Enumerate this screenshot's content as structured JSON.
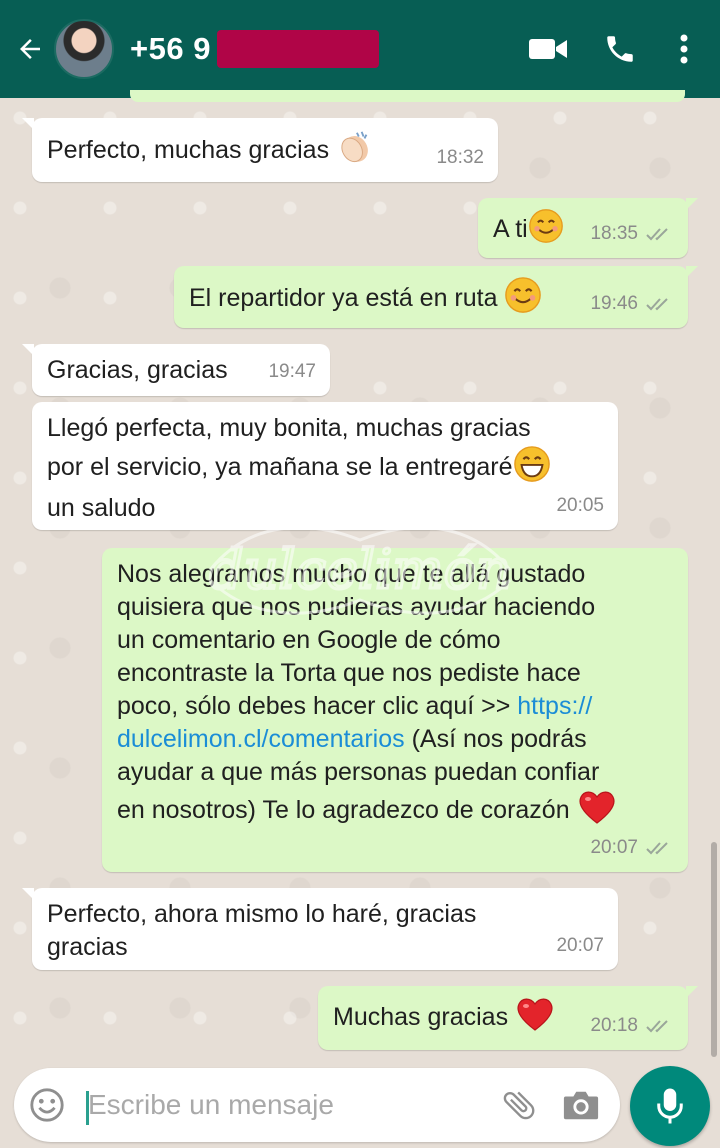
{
  "header": {
    "contact_name": "+56 9",
    "colors": {
      "bar": "#075e54",
      "redaction": "#b00547"
    },
    "icons": [
      "back-arrow-icon",
      "video-call-icon",
      "phone-icon",
      "more-vert-icon"
    ]
  },
  "messages": [
    {
      "dir": "in",
      "text": "Perfecto, muchas gracias",
      "emoji": "clapping-hands",
      "time": "18:32"
    },
    {
      "dir": "out",
      "text": "A ti",
      "emoji": "smiling-face",
      "time": "18:35",
      "read": true
    },
    {
      "dir": "out",
      "text": "El repartidor ya está en ruta",
      "emoji": "smiling-face",
      "time": "19:46",
      "read": true
    },
    {
      "dir": "in",
      "text": "Gracias, gracias",
      "time": "19:47"
    },
    {
      "dir": "in",
      "line1": "Llegó perfecta, muy bonita, muchas gracias",
      "line2": "por el servicio, ya mañana se la entregaré",
      "line3": "un saludo",
      "emoji": "grinning-face",
      "time": "20:05"
    },
    {
      "dir": "out",
      "line1": "Nos alegramos mucho que te allá gustado",
      "line2": "quisiera que nos pudieras ayudar haciendo",
      "line3": "un comentario en Google de cómo",
      "line4": "encontraste la Torta que nos pediste hace",
      "line5": "poco, sólo debes hacer clic aquí >> ",
      "link_a": "https://",
      "link_b": "dulcelimon.cl/comentarios",
      "line6_rest": " (Así nos podrás",
      "line7": "ayudar a que más personas puedan confiar",
      "line8": "en nosotros) Te lo agradezco de corazón",
      "emoji": "red-heart",
      "time": "20:07",
      "read": true
    },
    {
      "dir": "in",
      "line1": "Perfecto, ahora mismo lo haré, gracias",
      "line2": "gracias",
      "time": "20:07"
    },
    {
      "dir": "out",
      "text": "Muchas gracias",
      "emoji": "red-heart",
      "time": "20:18",
      "read": true
    }
  ],
  "watermark": {
    "text": "dulcelimón"
  },
  "composer": {
    "placeholder": "Escribe un mensaje",
    "icons": [
      "emoji-icon",
      "attach-icon",
      "camera-icon",
      "mic-icon"
    ],
    "colors": {
      "send": "#00897b",
      "caret": "#2aa08f"
    }
  },
  "theme": {
    "incoming": "#ffffff",
    "outgoing": "#dcf8c6",
    "link": "#1b8dd6",
    "background": "#e6ded6"
  }
}
